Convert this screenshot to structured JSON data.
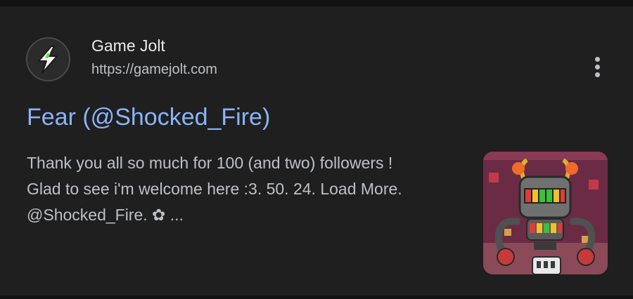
{
  "result": {
    "site_name": "Game Jolt",
    "site_url": "https://gamejolt.com",
    "title": "Fear (@Shocked_Fire)",
    "snippet_lines": [
      "Thank you all so much for 100 (and two) followers !",
      "Glad to see i'm welcome here :3. 50. 24. Load More.",
      "@Shocked_Fire. ✿ ..."
    ],
    "thumbnail_icon": "robot-character-image",
    "logo_icon": "gamejolt-lightning-logo",
    "more_icon": "more-vert-icon"
  },
  "colors": {
    "background": "#1f1f1f",
    "title_link": "#8ab4f8",
    "text": "#bdc1c6",
    "logo_green": "#6fdc3e"
  }
}
